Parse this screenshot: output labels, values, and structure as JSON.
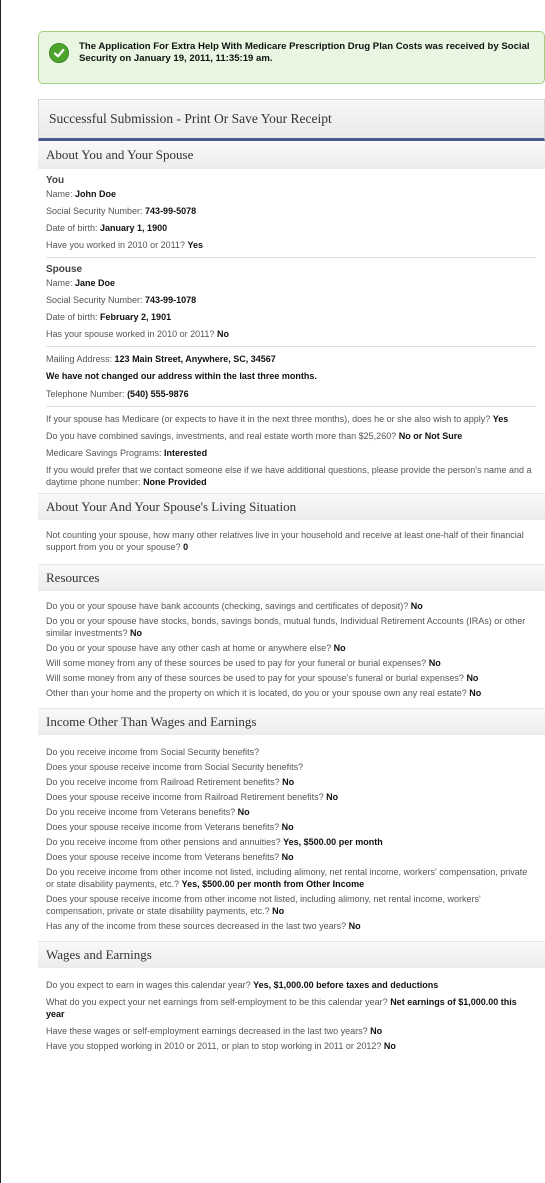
{
  "notice": {
    "message": "The Application For Extra Help With Medicare Prescription Drug Plan Costs was received by Social Security on January 19, 2011, 11:35:19 am."
  },
  "receipt": {
    "title": "Successful Submission - Print Or Save Your Receipt"
  },
  "about": {
    "title": "About You and Your Spouse",
    "you": {
      "heading": "You",
      "name_label": "Name: ",
      "name": "John Doe",
      "ssn_label": "Social Security Number: ",
      "ssn": "743-99-5078",
      "dob_label": "Date of birth: ",
      "dob": "January 1, 1900",
      "worked_label": "Have you worked in 2010 or 2011? ",
      "worked": "Yes"
    },
    "spouse": {
      "heading": "Spouse",
      "name_label": "Name: ",
      "name": "Jane Doe",
      "ssn_label": "Social Security Number: ",
      "ssn": "743-99-1078",
      "dob_label": "Date of birth: ",
      "dob": "February 2, 1901",
      "worked_label": "Has your spouse worked in 2010 or 2011? ",
      "worked": "No"
    },
    "mailing_label": "Mailing Address: ",
    "mailing": "123 Main Street, Anywhere, SC, 34567",
    "address_note": "We have not changed our address within the last three months.",
    "phone_label": "Telephone Number: ",
    "phone": "(540) 555-9876",
    "medicare_q": "If your spouse has Medicare (or expects to have it in the next three months), does he or she also wish to apply? ",
    "medicare_a": "Yes",
    "savings_q": "Do you have combined savings, investments, and real estate worth more than $25,260? ",
    "savings_a": "No or Not Sure",
    "msp_label": "Medicare Savings Programs: ",
    "msp": "Interested",
    "contact_q": "If you would prefer that we contact someone else if we have additional questions, please provide the person's name and a daytime phone number: ",
    "contact_a": "None Provided"
  },
  "living": {
    "title": "About Your And Your Spouse's Living Situation",
    "q": "Not counting your spouse, how many other relatives live in your household and receive at least one-half of their financial support from you or your spouse? ",
    "a": "0"
  },
  "resources": {
    "title": "Resources",
    "items": [
      {
        "q": "Do you or your spouse have bank accounts (checking, savings and certificates of deposit)? ",
        "a": "No"
      },
      {
        "q": "Do you or your spouse have stocks, bonds, savings bonds, mutual funds, Individual Retirement Accounts (IRAs) or other similar investments? ",
        "a": "No"
      },
      {
        "q": "Do you or your spouse have any other cash at home or anywhere else? ",
        "a": "No"
      },
      {
        "q": "Will some money from any of these sources be used to pay for your funeral or burial expenses? ",
        "a": "No"
      },
      {
        "q": "Will some money from any of these sources be used to pay for your spouse's funeral or burial expenses? ",
        "a": "No"
      },
      {
        "q": "Other than your home and the property on which it is located, do you or your spouse own any real estate? ",
        "a": "No"
      }
    ]
  },
  "income": {
    "title": "Income Other Than Wages and Earnings",
    "items": [
      {
        "q": "Do you receive income from Social Security benefits?",
        "a": ""
      },
      {
        "q": "Does your spouse receive income from Social Security benefits?",
        "a": ""
      },
      {
        "q": "Do you receive income from Railroad Retirement benefits? ",
        "a": "No"
      },
      {
        "q": "Does your spouse receive income from Railroad Retirement benefits? ",
        "a": "No"
      },
      {
        "q": "Do you receive income from Veterans benefits? ",
        "a": "No"
      },
      {
        "q": "Does your spouse receive income from Veterans benefits? ",
        "a": "No"
      },
      {
        "q": "Do you receive income from other pensions and annuities? ",
        "a": "Yes, $500.00 per month"
      },
      {
        "q": "Does your spouse receive income from Veterans benefits? ",
        "a": "No"
      },
      {
        "q": "Do you receive income from other income not listed, including alimony, net rental income, workers' compensation, private or state disability payments, etc.? ",
        "a": "Yes, $500.00 per month from Other Income"
      },
      {
        "q": "Does your spouse receive income from other income not listed, including alimony, net rental income, workers' compensation, private or state disability payments, etc.? ",
        "a": "No"
      },
      {
        "q": "Has any of the income from these sources decreased in the last two years? ",
        "a": "No"
      }
    ]
  },
  "wages": {
    "title": "Wages and Earnings",
    "items": [
      {
        "q": "Do you expect to earn in wages this calendar year? ",
        "a": "Yes, $1,000.00 before taxes and deductions"
      },
      {
        "q": "What do you expect your net earnings from self-employment to be this calendar year? ",
        "a": "Net earnings of $1,000.00 this year"
      },
      {
        "q": "Have these wages or self-employment earnings decreased in the last two years? ",
        "a": "No"
      },
      {
        "q": "Have you stopped working in 2010 or 2011, or plan to stop working in 2011 or 2012? ",
        "a": "No"
      }
    ]
  }
}
